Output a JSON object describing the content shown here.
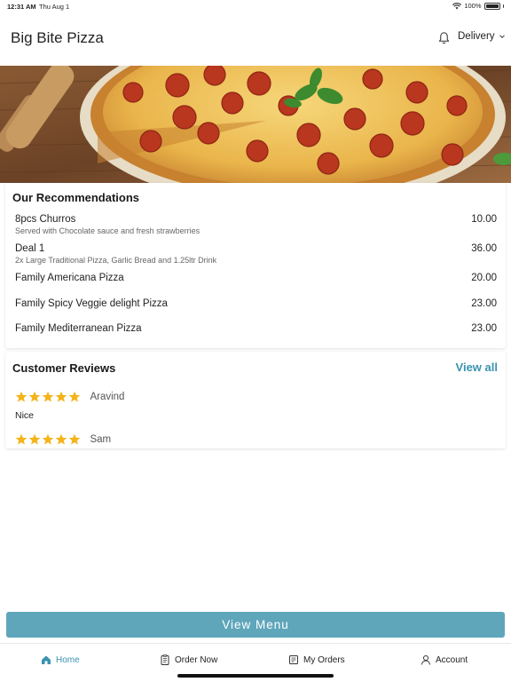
{
  "status_bar": {
    "time": "12:31 AM",
    "date": "Thu Aug 1",
    "battery": "100%",
    "icons": [
      "wifi-icon",
      "battery-icon"
    ]
  },
  "header": {
    "title": "Big Bite Pizza",
    "mode_label": "Delivery",
    "icons": [
      "bell-icon",
      "chevron-down-icon"
    ]
  },
  "hero": {
    "image": "pepperoni pizza banner"
  },
  "recommendations": {
    "title": "Our Recommendations",
    "items": [
      {
        "name": "8pcs Churros",
        "description": "Served with Chocolate sauce and fresh strawberries",
        "price": "10.00"
      },
      {
        "name": "Deal 1",
        "description": "2x Large Traditional Pizza, Garlic Bread and 1.25ltr Drink",
        "price": "36.00"
      },
      {
        "name": "Family Americana Pizza",
        "description": "",
        "price": "20.00"
      },
      {
        "name": "Family Spicy Veggie delight Pizza",
        "description": "",
        "price": "23.00"
      },
      {
        "name": "Family Mediterranean Pizza",
        "description": "",
        "price": "23.00"
      }
    ]
  },
  "reviews": {
    "title": "Customer Reviews",
    "view_all_label": "View all",
    "items": [
      {
        "reviewer": "Aravind",
        "rating": 5,
        "text": "Nice"
      },
      {
        "reviewer": "Sam",
        "rating": 5,
        "text": ""
      }
    ]
  },
  "view_menu_label": "View Menu",
  "tabbar": {
    "tabs": [
      {
        "label": "Home",
        "icon": "home-icon",
        "active": true
      },
      {
        "label": "Order Now",
        "icon": "clipboard-icon",
        "active": false
      },
      {
        "label": "My Orders",
        "icon": "receipt-icon",
        "active": false
      },
      {
        "label": "Account",
        "icon": "user-icon",
        "active": false
      }
    ]
  },
  "colors": {
    "accent": "#3a93b0",
    "button": "#5fa6bb",
    "star": "#f4b41a"
  }
}
